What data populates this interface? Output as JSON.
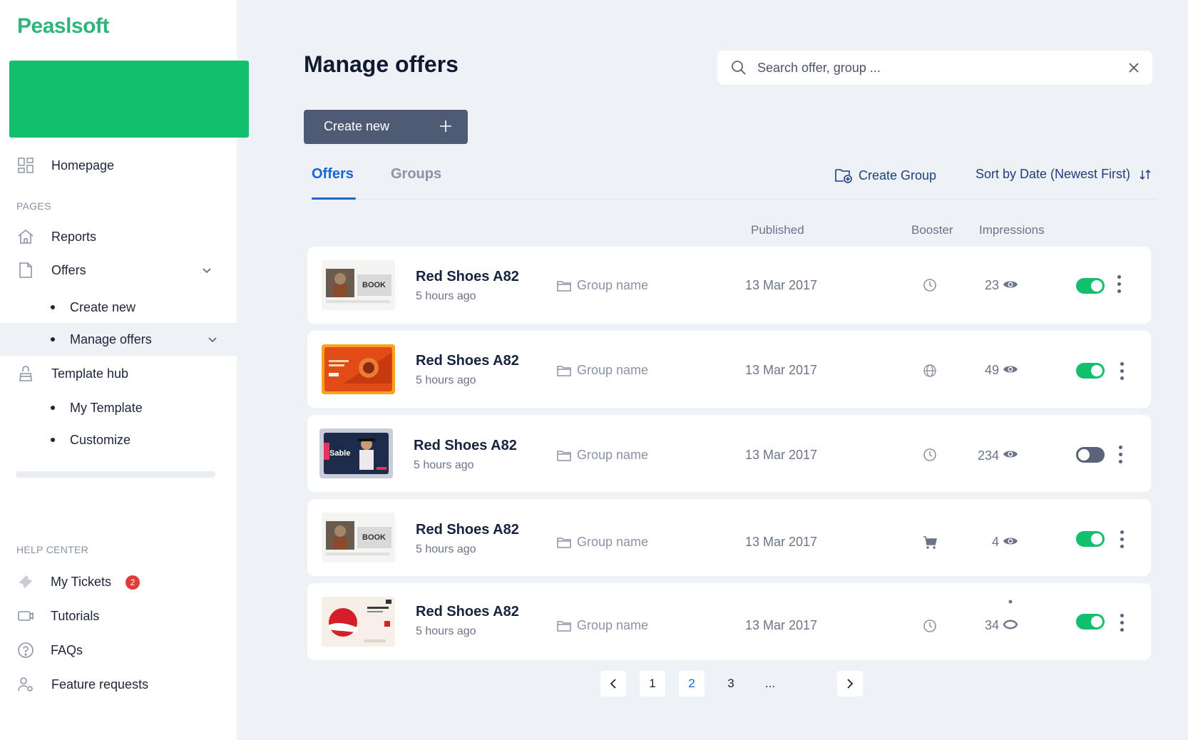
{
  "brand": {
    "logo_text": "Peaslsoft"
  },
  "sidebar": {
    "homepage": "Homepage",
    "pages_section": "PAGES",
    "reports": "Reports",
    "offers": "Offers",
    "offers_sub": [
      "Create new",
      "Manage offers"
    ],
    "template_hub": "Template hub",
    "template_sub": [
      "My Template",
      "Customize"
    ],
    "help_section": "HELP CENTER",
    "tickets": "My Tickets",
    "tickets_badge": "2",
    "tutorials": "Tutorials",
    "faqs": "FAQs",
    "feature_requests": "Feature requests"
  },
  "header": {
    "title": "Manage offers",
    "search_placeholder": "Search offer, group ...",
    "create_new": "Create new"
  },
  "tabs": {
    "offers": "Offers",
    "groups": "Groups"
  },
  "actions": {
    "create_group": "Create Group",
    "sort": "Sort by Date (Newest First)"
  },
  "columns": {
    "published": "Published",
    "booster": "Booster",
    "impressions": "Impressions"
  },
  "offers": [
    {
      "title": "Red Shoes A82",
      "time": "5 hours ago",
      "group": "Group name",
      "published": "13 Mar 2017",
      "booster_icon": "clock-icon",
      "impressions": "23",
      "enabled": true
    },
    {
      "title": "Red Shoes A82",
      "time": "5 hours ago",
      "group": "Group name",
      "published": "13 Mar 2017",
      "booster_icon": "globe-icon",
      "impressions": "49",
      "enabled": true
    },
    {
      "title": "Red Shoes A82",
      "time": "5 hours ago",
      "group": "Group name",
      "published": "13 Mar 2017",
      "booster_icon": "clock-icon",
      "impressions": "234",
      "enabled": false
    },
    {
      "title": "Red Shoes A82",
      "time": "5 hours ago",
      "group": "Group name",
      "published": "13 Mar 2017",
      "booster_icon": "cart-icon",
      "impressions": "4",
      "enabled": true
    },
    {
      "title": "Red Shoes A82",
      "time": "5 hours ago",
      "group": "Group name",
      "published": "13 Mar 2017",
      "booster_icon": "clock-icon",
      "impressions": "34",
      "enabled": true
    }
  ],
  "thumb_labels": {
    "boot": "BOOK",
    "sable": "Sable"
  },
  "pagination": {
    "pages": [
      "1",
      "2",
      "3",
      "..."
    ],
    "current": "2"
  },
  "colors": {
    "accent": "#1565d8",
    "brand_green": "#12bf6c",
    "sidebar_bg": "#ffffff",
    "page_bg": "#eef1f5",
    "badge_red": "#e23b3b"
  }
}
